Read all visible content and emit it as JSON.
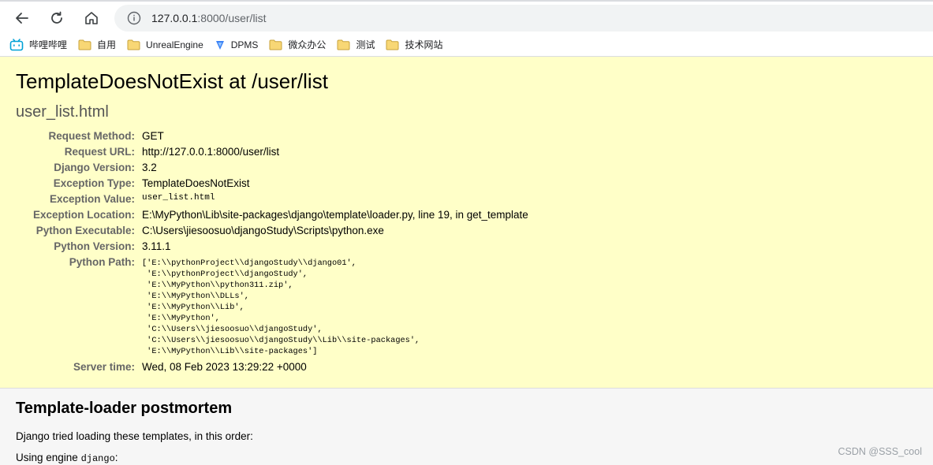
{
  "browser": {
    "url_host": "127.0.0.1",
    "url_rest": ":8000/user/list",
    "bookmarks": [
      {
        "label": "哔哩哔哩",
        "icon": "bilibili-icon"
      },
      {
        "label": "自用",
        "icon": "folder-icon"
      },
      {
        "label": "UnrealEngine",
        "icon": "folder-icon"
      },
      {
        "label": "DPMS",
        "icon": "dpms-icon"
      },
      {
        "label": "微众办公",
        "icon": "folder-icon"
      },
      {
        "label": "测试",
        "icon": "folder-icon"
      },
      {
        "label": "技术网站",
        "icon": "folder-icon"
      }
    ]
  },
  "error": {
    "title": "TemplateDoesNotExist at /user/list",
    "subtitle": "user_list.html",
    "rows": [
      {
        "label": "Request Method:",
        "value": "GET"
      },
      {
        "label": "Request URL:",
        "value": "http://127.0.0.1:8000/user/list"
      },
      {
        "label": "Django Version:",
        "value": "3.2"
      },
      {
        "label": "Exception Type:",
        "value": "TemplateDoesNotExist"
      },
      {
        "label": "Exception Value:",
        "value": "user_list.html"
      },
      {
        "label": "Exception Location:",
        "value": "E:\\MyPython\\Lib\\site-packages\\django\\template\\loader.py, line 19, in get_template"
      },
      {
        "label": "Python Executable:",
        "value": "C:\\Users\\jiesoosuo\\djangoStudy\\Scripts\\python.exe"
      },
      {
        "label": "Python Version:",
        "value": "3.11.1"
      },
      {
        "label": "Python Path:",
        "value": "['E:\\\\pythonProject\\\\djangoStudy\\\\django01',\n 'E:\\\\pythonProject\\\\djangoStudy',\n 'E:\\\\MyPython\\\\python311.zip',\n 'E:\\\\MyPython\\\\DLLs',\n 'E:\\\\MyPython\\\\Lib',\n 'E:\\\\MyPython',\n 'C:\\\\Users\\\\jiesoosuo\\\\djangoStudy',\n 'C:\\\\Users\\\\jiesoosuo\\\\djangoStudy\\\\Lib\\\\site-packages',\n 'E:\\\\MyPython\\\\Lib\\\\site-packages']"
      },
      {
        "label": "Server time:",
        "value": "Wed, 08 Feb 2023 13:29:22 +0000"
      }
    ]
  },
  "postmortem": {
    "title": "Template-loader postmortem",
    "intro": "Django tried loading these templates, in this order:",
    "engine_prefix": "Using engine ",
    "engine_name": "django",
    "engine_suffix": ":"
  },
  "watermark": "CSDN @SSS_cool"
}
